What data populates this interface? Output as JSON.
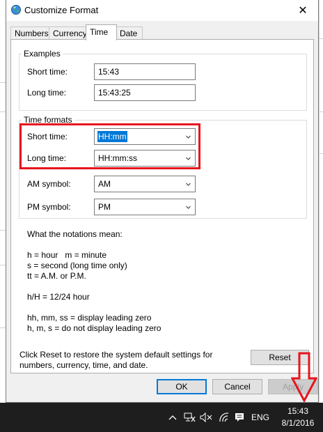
{
  "window": {
    "title": "Customize Format",
    "close_glyph": "✕"
  },
  "tabs": [
    {
      "label": "Numbers"
    },
    {
      "label": "Currency"
    },
    {
      "label": "Time"
    },
    {
      "label": "Date"
    }
  ],
  "active_tab": "Time",
  "examples": {
    "heading": "Examples",
    "short_time_label": "Short time:",
    "short_time_value": "15:43",
    "long_time_label": "Long time:",
    "long_time_value": "15:43:25"
  },
  "time_formats": {
    "heading": "Time formats",
    "short_time_label": "Short time:",
    "short_time_value": "HH:mm",
    "long_time_label": "Long time:",
    "long_time_value": "HH:mm:ss",
    "am_label": "AM symbol:",
    "am_value": "AM",
    "pm_label": "PM symbol:",
    "pm_value": "PM"
  },
  "notations": {
    "heading": "What the notations mean:",
    "line1": "h = hour   m = minute",
    "line2": "s = second (long time only)",
    "line3": "tt = A.M. or P.M.",
    "line4": "h/H = 12/24 hour",
    "line5": "hh, mm, ss = display leading zero",
    "line6": "h, m, s = do not display leading zero"
  },
  "reset_info": {
    "line1": "Click Reset to restore the system default settings for",
    "line2": "numbers, currency, time, and date."
  },
  "buttons": {
    "reset": "Reset",
    "ok": "OK",
    "cancel": "Cancel",
    "apply": "Apply"
  },
  "taskbar": {
    "language": "ENG",
    "time": "15:43",
    "date": "8/1/2016",
    "icons": [
      "chevron-up-icon",
      "network-icon",
      "volume-mute-icon",
      "wifi-icon",
      "notification-icon"
    ]
  },
  "colors": {
    "highlight": "#e8141c",
    "selection": "#0078d7",
    "taskbar": "#1e1e1e"
  }
}
